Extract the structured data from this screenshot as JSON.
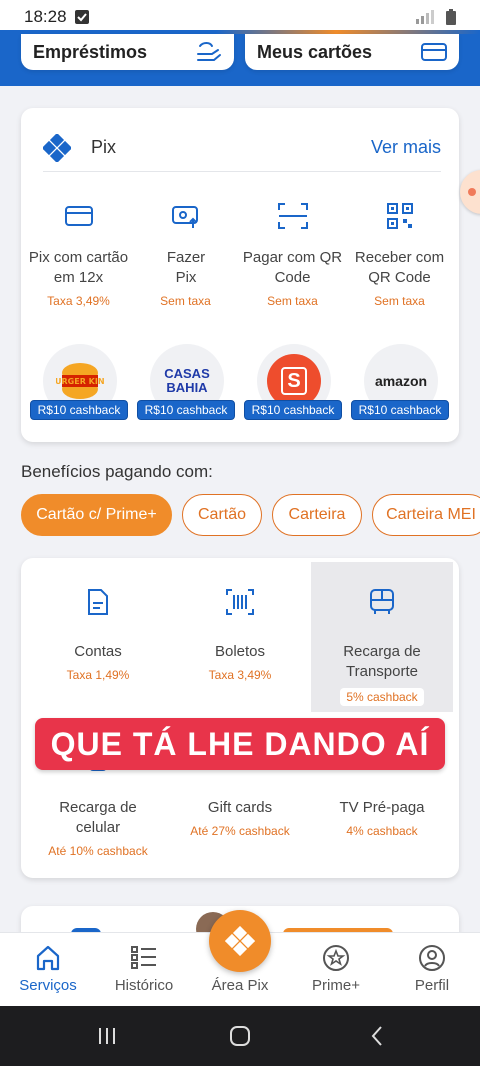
{
  "status_bar": {
    "time": "18:28"
  },
  "top_cards": {
    "loans": "Empréstimos",
    "cards": "Meus cartões"
  },
  "pix": {
    "title": "Pix",
    "see_more": "Ver mais",
    "actions": [
      {
        "label": "Pix com cartão em 12x",
        "sub": "Taxa 3,49%",
        "icon": "credit-card-icon"
      },
      {
        "label": "Fazer Pix",
        "sub": "Sem taxa",
        "icon": "send-pix-icon"
      },
      {
        "label": "Pagar com QR Code",
        "sub": "Sem taxa",
        "icon": "qr-scan-icon"
      },
      {
        "label": "Receber com QR Code",
        "sub": "Sem taxa",
        "icon": "qr-code-icon"
      }
    ],
    "partners": [
      {
        "logo_text": "BURGER KING",
        "badge": "R$10 cashback"
      },
      {
        "logo_text": "CASAS BAHIA",
        "badge": "R$10 cashback"
      },
      {
        "logo_text": "S",
        "badge": "R$10 cashback"
      },
      {
        "logo_text": "amazon",
        "badge": "R$10 cashback"
      }
    ]
  },
  "benefits": {
    "title": "Benefícios pagando com:",
    "chips": [
      "Cartão c/ Prime+",
      "Cartão",
      "Carteira",
      "Carteira MEI"
    ]
  },
  "services": [
    {
      "label": "Contas",
      "sub": "Taxa 1,49%",
      "icon": "bill-icon"
    },
    {
      "label": "Boletos",
      "sub": "Taxa 3,49%",
      "icon": "barcode-icon"
    },
    {
      "label": "Recarga de Transporte",
      "sub": "5% cashback",
      "icon": "bus-icon"
    },
    {
      "label": "Recarga de celular",
      "sub": "Até 10% cashback",
      "icon": "phone-icon"
    },
    {
      "label": "Gift cards",
      "sub": "Até 27% cashback",
      "icon": "gift-icon"
    },
    {
      "label": "TV Pré-paga",
      "sub": "4% cashback",
      "icon": "tv-icon"
    }
  ],
  "overlay_caption": "QUE TÁ LHE DANDO AÍ",
  "bottom_nav": [
    {
      "label": "Serviços",
      "icon": "home-icon"
    },
    {
      "label": "Histórico",
      "icon": "list-icon"
    },
    {
      "label": "Área Pix",
      "icon": "pix-icon"
    },
    {
      "label": "Prime+",
      "icon": "star-icon"
    },
    {
      "label": "Perfil",
      "icon": "user-icon"
    }
  ],
  "colors": {
    "primary": "#1a66c9",
    "accent": "#f08c2a",
    "caption_bg": "#e8344a"
  }
}
